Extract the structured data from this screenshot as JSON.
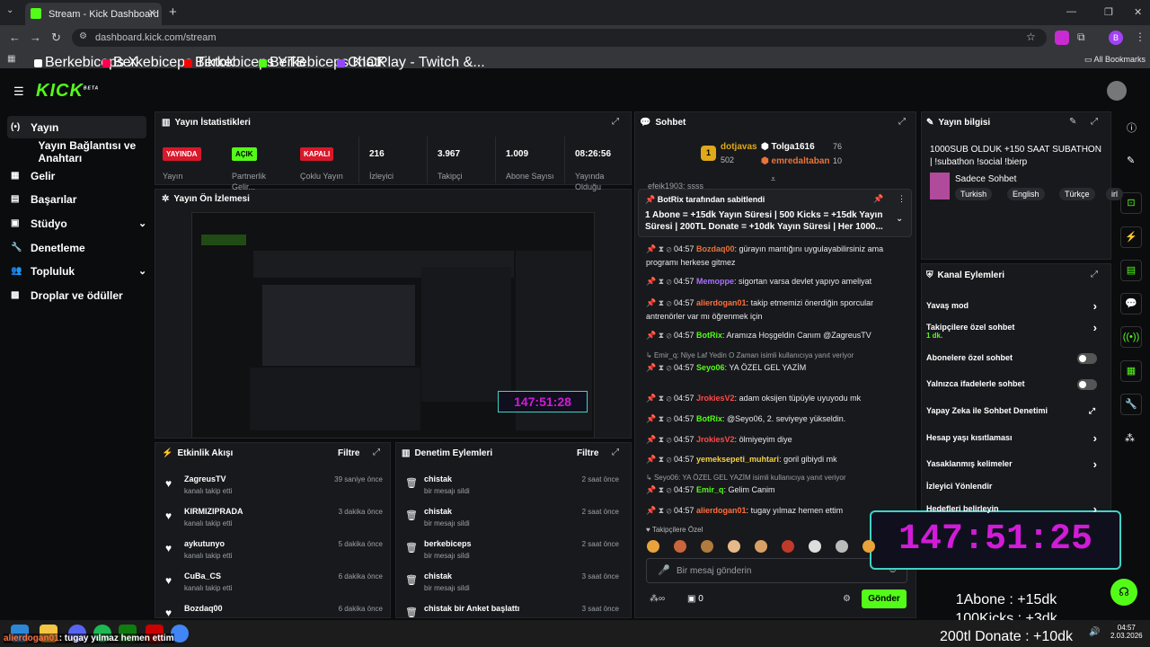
{
  "browser": {
    "tab_title": "Stream - Kick Dashboard",
    "url": "dashboard.kick.com/stream",
    "profile_initial": "B",
    "bookmarks": [
      {
        "label": "Berkebiceps X",
        "color": "#ffffff"
      },
      {
        "label": "Berkebiceps Tiktok",
        "color": "#ff0050"
      },
      {
        "label": "Berkebiceps YTB",
        "color": "#ff0000"
      },
      {
        "label": "Berkebiceps KICK",
        "color": "#53fc18"
      },
      {
        "label": "ChatPlay - Twitch &...",
        "color": "#9147ff"
      }
    ],
    "all_bookmarks": "All Bookmarks"
  },
  "site": {
    "logo": "KICK",
    "logo_beta": "BETA",
    "nav": [
      {
        "label": "Yayın",
        "icon": "(•)"
      },
      {
        "label": "Yayın Bağlantısı ve Anahtarı",
        "icon": ""
      },
      {
        "label": "Gelir",
        "icon": "▦"
      },
      {
        "label": "Başarılar",
        "icon": "▤"
      },
      {
        "label": "Stüdyo",
        "icon": "▣"
      },
      {
        "label": "Denetleme",
        "icon": "🔧"
      },
      {
        "label": "Topluluk",
        "icon": "👥"
      },
      {
        "label": "Droplar ve ödüller",
        "icon": "▩"
      }
    ]
  },
  "stats": {
    "title": "Yayın İstatistikleri",
    "items": [
      {
        "value": "YAYINDA",
        "label": "Yayın",
        "kind": "red"
      },
      {
        "value": "AÇIK",
        "label": "Partnerlik Gelir...",
        "kind": "grn"
      },
      {
        "value": "KAPALI",
        "label": "Çoklu Yayın",
        "kind": "red"
      },
      {
        "value": "216",
        "label": "İzleyici",
        "kind": "num"
      },
      {
        "value": "3.967",
        "label": "Takipçi",
        "kind": "num"
      },
      {
        "value": "1.009",
        "label": "Abone Sayısı",
        "kind": "num"
      },
      {
        "value": "08:26:56",
        "label": "Yayında Olduğu",
        "kind": "num"
      }
    ]
  },
  "preview": {
    "title": "Yayın Ön İzlemesi",
    "timer": "147:51:28"
  },
  "activity": {
    "title": "Etkinlik Akışı",
    "filter": "Filtre",
    "items": [
      {
        "name": "ZagreusTV",
        "sub": "kanalı takip etti",
        "time": "39 saniye önce"
      },
      {
        "name": "KIRMIZIPRADA",
        "sub": "kanalı takip etti",
        "time": "3 dakika önce"
      },
      {
        "name": "aykutunyo",
        "sub": "kanalı takip etti",
        "time": "5 dakika önce"
      },
      {
        "name": "CuBa_CS",
        "sub": "kanalı takip etti",
        "time": "6 dakika önce"
      },
      {
        "name": "Bozdaq00",
        "sub": "",
        "time": "6 dakika önce"
      }
    ]
  },
  "moderation": {
    "title": "Denetim Eylemleri",
    "filter": "Filtre",
    "items": [
      {
        "name": "chistak",
        "sub": "bir mesajı sildi",
        "time": "2 saat önce"
      },
      {
        "name": "chistak",
        "sub": "bir mesajı sildi",
        "time": "2 saat önce"
      },
      {
        "name": "berkebiceps",
        "sub": "bir mesajı sildi",
        "time": "2 saat önce"
      },
      {
        "name": "chistak",
        "sub": "bir mesajı sildi",
        "time": "3 saat önce"
      },
      {
        "name": "chistak bir Anket başlattı",
        "sub": "",
        "time": "3 saat önce"
      }
    ]
  },
  "chat": {
    "title": "Sohbet",
    "top_gifter": {
      "rank": "1",
      "name": "dotjavas",
      "count": "502"
    },
    "gifters": [
      {
        "name": "Tolga1616",
        "count": "76"
      },
      {
        "name": "emredaltaban",
        "count": "10"
      }
    ],
    "partial_line": "efeik1903: ssss",
    "pinned": {
      "by": "BotRix tarafından sabitlendi",
      "text": "1 Abone = +15dk Yayın Süresi | 500 Kicks = +15dk Yayın Süresi | 200TL Donate = +10dk Yayın Süresi | Her 1000..."
    },
    "messages": [
      {
        "time": "04:57",
        "user": "Bozdaq00",
        "color": "#e8743b",
        "text": "gürayın mantığını uygulayabilirsiniz ama programı herkese gitmez",
        "reply": ""
      },
      {
        "time": "04:57",
        "user": "Memoppe",
        "color": "#a970ff",
        "text": "sigortan varsa devlet yapıyo ameliyat",
        "reply": ""
      },
      {
        "time": "04:57",
        "user": "alierdogan01",
        "color": "#ff6f3c",
        "text": "takip etmemizi önerdiğin sporcular antrenörler var mı öğrenmek için",
        "reply": ""
      },
      {
        "time": "04:57",
        "user": "BotRix",
        "color": "#53fc18",
        "text": "Aramıza Hoşgeldin Canım @ZagreusTV",
        "reply": ""
      },
      {
        "time": "04:57",
        "user": "Seyo06",
        "color": "#53fc18",
        "text": "YA ÖZEL GEL YAZİM",
        "reply": "Emir_q: Niye Laf Yedin O Zaman isimli kullanıcıya yanıt veriyor"
      },
      {
        "time": "04:57",
        "user": "JrokiesV2",
        "color": "#ff4a4a",
        "text": "adam oksijen tüpüyle uyuyodu mk",
        "reply": ""
      },
      {
        "time": "04:57",
        "user": "BotRix",
        "color": "#53fc18",
        "text": "@Seyo06, 2. seviyeye yükseldin.",
        "reply": ""
      },
      {
        "time": "04:57",
        "user": "JrokiesV2",
        "color": "#ff4a4a",
        "text": "ölmiyeyim diye",
        "reply": ""
      },
      {
        "time": "04:57",
        "user": "yemeksepeti_muhtari",
        "color": "#f5d142",
        "text": "goril gibiydi mk",
        "reply": ""
      },
      {
        "time": "04:57",
        "user": "Emir_q",
        "color": "#53fc18",
        "text": "Gelim Canim",
        "reply": "Seyo06: YA ÖZEL GEL YAZİM isimli kullanıcıya yanıt veriyor"
      },
      {
        "time": "04:57",
        "user": "alierdogan01",
        "color": "#ff6f3c",
        "text": "tugay yılmaz hemen ettim",
        "reply": ""
      }
    ],
    "followers_only": "Takipçilere Özel",
    "input_placeholder": "Bir mesaj gönderin",
    "viewer_count": "0",
    "send_label": "Gönder"
  },
  "info": {
    "title": "Yayın bilgisi",
    "stream_title": "1000SUB OLDUK +150 SAAT SUBATHON | !subathon !social !bierp",
    "category": "Sadece Sohbet",
    "tags": [
      "Turkish",
      "English",
      "Türkçe",
      "irl"
    ]
  },
  "channel_actions": {
    "title": "Kanal Eylemleri",
    "items": [
      {
        "label": "Yavaş mod",
        "sub": "",
        "ctrl": "arrow"
      },
      {
        "label": "Takipçilere özel sohbet",
        "sub": "1 dk.",
        "ctrl": "arrow"
      },
      {
        "label": "Abonelere özel sohbet",
        "sub": "",
        "ctrl": "toggle"
      },
      {
        "label": "Yalnızca ifadelerle sohbet",
        "sub": "",
        "ctrl": "toggle"
      },
      {
        "label": "Yapay Zeka ile Sohbet Denetimi",
        "sub": "",
        "ctrl": "ext"
      },
      {
        "label": "Hesap yaşı kısıtlaması",
        "sub": "",
        "ctrl": "arrow"
      },
      {
        "label": "Yasaklanmış kelimeler",
        "sub": "",
        "ctrl": "arrow"
      },
      {
        "label": "İzleyici Yönlendir",
        "sub": "",
        "ctrl": "none"
      },
      {
        "label": "Hedefleri belirleyin",
        "sub": "",
        "ctrl": "arrow"
      }
    ]
  },
  "overlay": {
    "timer": "147:51:25",
    "lines": [
      "1Abone : +15dk",
      "100Kicks : +3dk",
      "200tl Donate : +10dk"
    ]
  },
  "taskbar": {
    "caption_user": "alierdogan01",
    "caption_text": ": tugay yılmaz hemen ettim",
    "time": "04:57",
    "date": "2.03.2026"
  }
}
